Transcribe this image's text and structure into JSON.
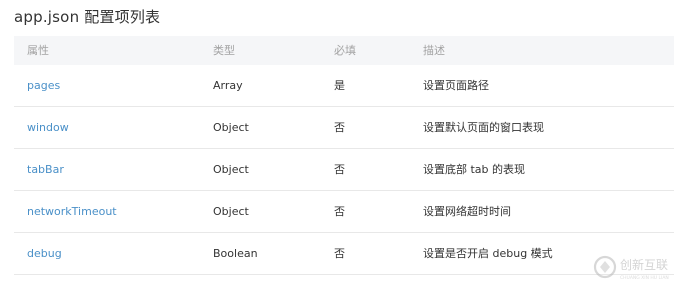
{
  "page": {
    "title": "app.json 配置项列表"
  },
  "table": {
    "headers": [
      "属性",
      "类型",
      "必填",
      "描述"
    ],
    "rows": [
      [
        "pages",
        "Array",
        "是",
        "设置页面路径"
      ],
      [
        "window",
        "Object",
        "否",
        "设置默认页面的窗口表现"
      ],
      [
        "tabBar",
        "Object",
        "否",
        "设置底部 tab 的表现"
      ],
      [
        "networkTimeout",
        "Object",
        "否",
        "设置网络超时时间"
      ],
      [
        "debug",
        "Boolean",
        "否",
        "设置是否开启 debug 模式"
      ]
    ]
  },
  "watermark": {
    "brand": "创新互联",
    "sub": "CHUANG XIN HU LIAN"
  },
  "colors": {
    "link": "#4a90c8",
    "header_bg": "#f5f6f8",
    "header_text": "#a3a3a3",
    "divider": "#e8e8e8"
  }
}
